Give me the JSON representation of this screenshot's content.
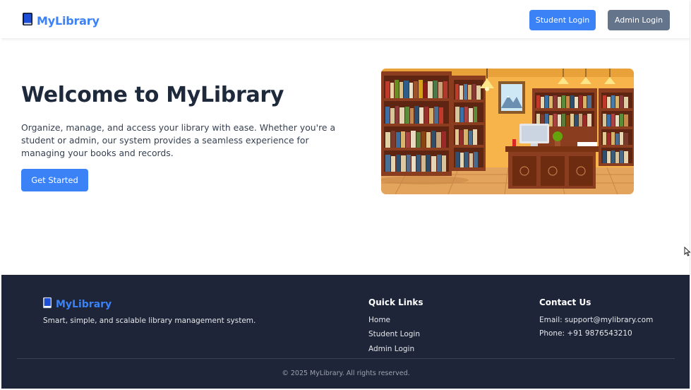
{
  "header": {
    "brand": "MyLibrary",
    "student_login": "Student Login",
    "admin_login": "Admin Login"
  },
  "hero": {
    "title": "Welcome to MyLibrary",
    "description": "Organize, manage, and access your library with ease. Whether you're a student or admin, our system provides a seamless experience for managing your books and records.",
    "cta": "Get Started"
  },
  "footer": {
    "brand": "MyLibrary",
    "tagline": "Smart, simple, and scalable library management system.",
    "quick_links": {
      "title": "Quick Links",
      "items": [
        "Home",
        "Student Login",
        "Admin Login"
      ]
    },
    "contact": {
      "title": "Contact Us",
      "email": "Email: support@mylibrary.com",
      "phone": "Phone: +91 9876543210"
    },
    "copyright": "© 2025 MyLibrary. All rights reserved."
  },
  "colors": {
    "accent": "#3b82f6",
    "secondary_button": "#64748b",
    "footer_bg": "#1e2538",
    "title_text": "#1e293b"
  },
  "icons": {
    "brand": "book-icon",
    "cursor": "mouse-pointer-icon"
  }
}
